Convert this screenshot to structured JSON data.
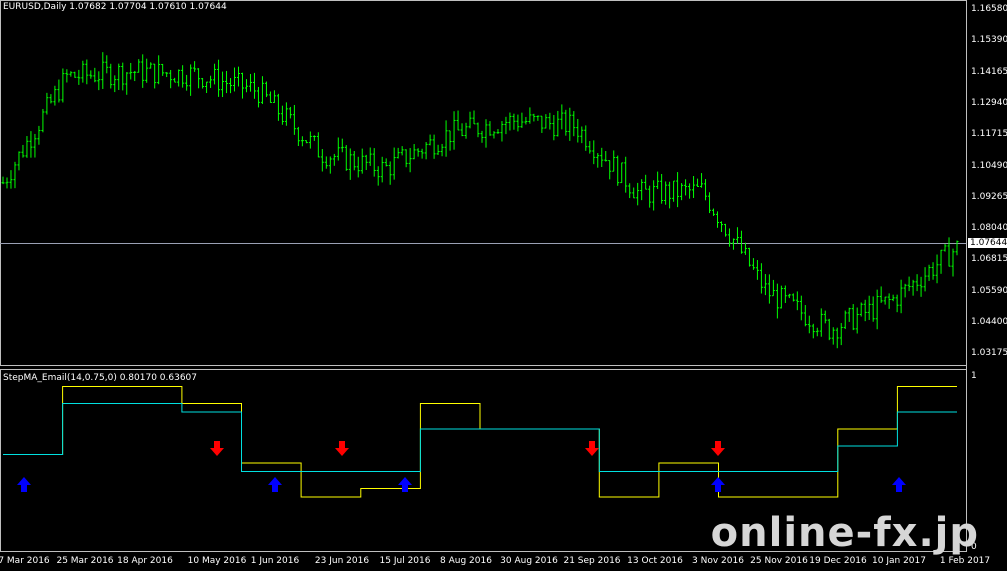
{
  "main": {
    "title": "EURUSD,Daily  1.07682 1.07704 1.07610 1.07644",
    "price_axis": [
      "1.16580",
      "1.15390",
      "1.14165",
      "1.12940",
      "1.11715",
      "1.10490",
      "1.09265",
      "1.08040",
      "1.06815",
      "1.05590",
      "1.04400",
      "1.03175"
    ],
    "current_price": "1.07644"
  },
  "indicator": {
    "title": "StepMA_Email(14,0.75,0) 0.80170 0.63607",
    "axis_top": "1",
    "axis_bottom": "0"
  },
  "time_axis": [
    "7 Mar 2016",
    "25 Mar 2016",
    "18 Apr 2016",
    "10 May 2016",
    "1 Jun 2016",
    "23 Jun 2016",
    "15 Jul 2016",
    "8 Aug 2016",
    "30 Aug 2016",
    "21 Sep 2016",
    "13 Oct 2016",
    "3 Nov 2016",
    "25 Nov 2016",
    "19 Dec 2016",
    "10 Jan 2017",
    "1 Feb 2017"
  ],
  "watermark": "online-fx.jp",
  "colors": {
    "bars": "#00ff00",
    "step_line": "#ffff00",
    "ma_line": "#00e0e0",
    "buy_arrow": "#0000ff",
    "sell_arrow": "#ff0000"
  },
  "chart_data": [
    {
      "type": "ohlc",
      "title": "EURUSD,Daily",
      "ylim": [
        1.03175,
        1.1658
      ],
      "x": [
        "7 Mar 2016",
        "25 Mar 2016",
        "18 Apr 2016",
        "10 May 2016",
        "1 Jun 2016",
        "23 Jun 2016",
        "15 Jul 2016",
        "8 Aug 2016",
        "30 Aug 2016",
        "21 Sep 2016",
        "13 Oct 2016",
        "3 Nov 2016",
        "25 Nov 2016",
        "19 Dec 2016",
        "10 Jan 2017",
        "1 Feb 2017"
      ],
      "close_approx": [
        1.1,
        1.139,
        1.141,
        1.14,
        1.134,
        1.111,
        1.105,
        1.118,
        1.123,
        1.121,
        1.096,
        1.097,
        1.06,
        1.046,
        1.057,
        1.076
      ],
      "current": 1.07644
    },
    {
      "type": "line",
      "title": "StepMA_Email(14,0.75,0)",
      "ylim": [
        0,
        1
      ],
      "series": [
        {
          "name": "step",
          "values": [
            0.55,
            0.95,
            0.95,
            0.85,
            0.5,
            0.3,
            0.35,
            0.85,
            0.7,
            0.7,
            0.3,
            0.5,
            0.3,
            0.3,
            0.7,
            0.95
          ]
        },
        {
          "name": "ma",
          "values": [
            0.55,
            0.85,
            0.85,
            0.8,
            0.45,
            0.45,
            0.45,
            0.7,
            0.7,
            0.7,
            0.45,
            0.45,
            0.45,
            0.45,
            0.6,
            0.8
          ]
        }
      ],
      "buy_signals": [
        "7 Mar 2016",
        "1 Jun 2016",
        "15 Jul 2016",
        "3 Nov 2016",
        "10 Jan 2017"
      ],
      "sell_signals": [
        "10 May 2016",
        "23 Jun 2016",
        "21 Sep 2016",
        "3 Nov 2016"
      ]
    }
  ]
}
